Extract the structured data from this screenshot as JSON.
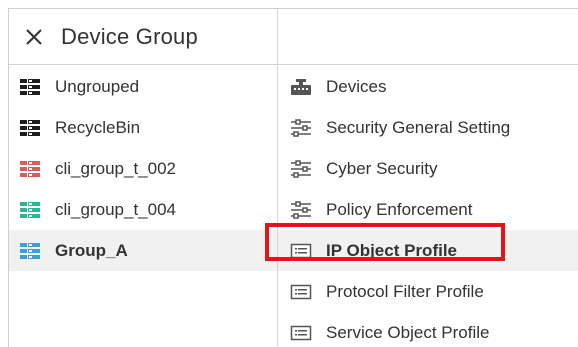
{
  "header": {
    "title": "Device Group"
  },
  "groups": [
    {
      "label": "Ungrouped",
      "color": "#1e1e1e",
      "selected": false
    },
    {
      "label": "RecycleBin",
      "color": "#1e1e1e",
      "selected": false
    },
    {
      "label": "cli_group_t_002",
      "color": "#e05a5a",
      "selected": false
    },
    {
      "label": "cli_group_t_004",
      "color": "#2bb59a",
      "selected": false
    },
    {
      "label": "Group_A",
      "color": "#3aa0db",
      "selected": true
    }
  ],
  "menu": [
    {
      "label": "Devices",
      "icon": "devices-icon"
    },
    {
      "label": "Security General Setting",
      "icon": "sliders-icon"
    },
    {
      "label": "Cyber Security",
      "icon": "sliders-icon"
    },
    {
      "label": "Policy Enforcement",
      "icon": "sliders-icon"
    },
    {
      "label": "IP Object Profile",
      "icon": "profile-icon",
      "highlighted": true
    },
    {
      "label": "Protocol Filter Profile",
      "icon": "profile-icon"
    },
    {
      "label": "Service Object Profile",
      "icon": "profile-icon"
    }
  ],
  "colors": {
    "highlight": "#e3141b",
    "selected_bg": "#f1f1f1"
  }
}
